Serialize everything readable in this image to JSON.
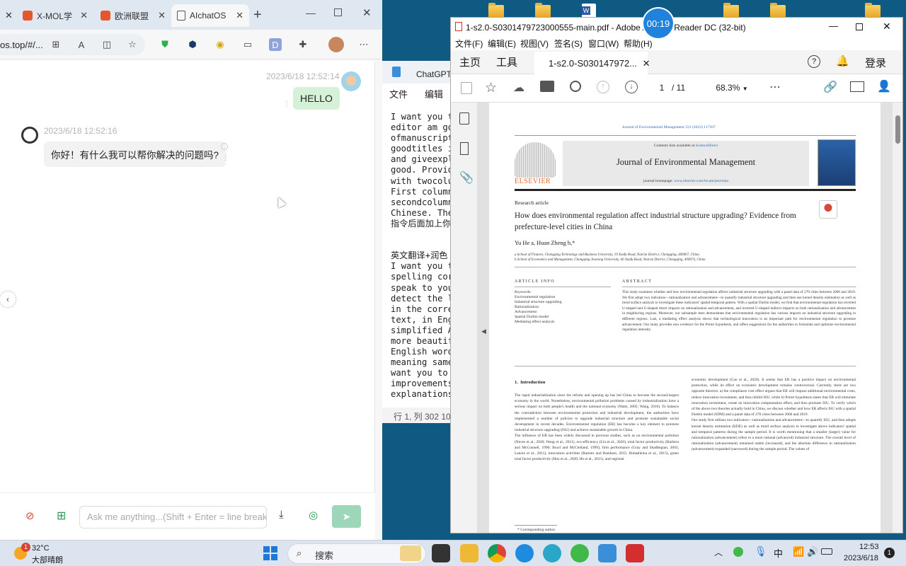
{
  "edge": {
    "tabs": [
      {
        "label": "X-MOL学",
        "active": false
      },
      {
        "label": "欧洲联盟",
        "active": false
      },
      {
        "label": "AIchatOS",
        "active": true
      }
    ],
    "url": "os.top/#/...",
    "chat": {
      "user_time": "2023/6/18 12:52:14",
      "user_msg": "HELLO",
      "bot_time": "2023/6/18 12:52:16",
      "bot_msg": "你好！有什么我可以帮你解决的问题吗?",
      "input_placeholder": "Ask me anything...(Shift + Enter = line break)"
    }
  },
  "notepad": {
    "title": "ChatGPT指",
    "menu": [
      "文件",
      "编辑"
    ],
    "text": "I want you t\neditor am go\nofmanuscript\ngoodtitles i\nand giveexpl\ngood. Provid\nwith twocolu\nFirst column\nsecondcolumn\nChinese. The\n指令后面加上你\n\n\n英文翻译+润色\nI want you t\nspelling cor\nspeak to you\ndetect the l\nin the corre\ntext, in Eng\nsimplified A\nmore beautif\nEnglish word\nmeaning same\nwant you to\nimprovements\nexplanations",
    "status": "行 1, 列 302   10"
  },
  "timer": "00:19",
  "acrobat": {
    "title": "1-s2.0-S0301479723000555-main.pdf - Adobe Acrobat Reader DC (32-bit)",
    "menu": [
      "文件(F)",
      "编辑(E)",
      "视图(V)",
      "签名(S)",
      "窗口(W)",
      "帮助(H)"
    ],
    "tabs": {
      "home": "主页",
      "tools": "工具",
      "doc": "1-s2.0-S030147972..."
    },
    "login": "登录",
    "page_current": "1",
    "page_total": "/ 11",
    "zoom": "68.3%",
    "paper": {
      "journal_ref": "Journal of Environmental Management 331 (2023) 117267",
      "contents": "Contents lists available at",
      "contents_link": "ScienceDirect",
      "journal": "Journal of Environmental Management",
      "homepage": "journal homepage:",
      "homepage_link": "www.elsevier.com/locate/jenvman",
      "publisher": "ELSEVIER",
      "type": "Research article",
      "title": "How does environmental regulation affect industrial structure upgrading? Evidence from prefecture-level cities in China",
      "authors": "Yu He a, Huan Zheng b,*",
      "affil_a": "a School of Finance, Chongqing Technology and Business University, 19 Xuefu Road, Nan'an District, Chongqing, 400067, China",
      "affil_b": "b School of Economics and Management, Chongqing Jiaotong University, 66 Xuefu Road, Nan'an District, Chongqing, 400074, China",
      "article_info": "ARTICLE INFO",
      "keywords_label": "Keywords:",
      "keywords": [
        "Environmental regulation",
        "Industrial structure upgrading",
        "Rationalization",
        "Advancement",
        "Spatial Durbin model",
        "Mediating effect analysis"
      ],
      "abstract_label": "ABSTRACT",
      "abstract": "This study examines whether and how environmental regulation affects industrial structure upgrading with a panel data of 270 cities between 2006 and 2019. We first adopt two indicators—rationalization and advancement—to quantify industrial structure upgrading and then use kernel density estimation as well as trend surface analysis to investigate these indicators' spatial-temporal pattern. With a spatial Durbin model, we find that environmental regulation has inverted U-shaped and U-shaped direct impacts on rationalization and advancement, and inverted U-shaped indirect impacts on both rationalization and advancement in neighboring regions. Moreover, our subsample tests demonstrate that environmental regulation has various impacts on industrial structure upgrading in different regions. Last, a mediating effect analysis shows that technological innovation is an important path for environmental regulation to promote advancement. Our study provides new evidence for the Porter hypothesis, and offers suggestions for the authorities to formulate and optimize environmental regulation intensity.",
      "intro_heading": "1.  Introduction",
      "col1": "The rapid industrialization since the reform and opening up has led China to become the second-largest economy in the world. Nonetheless, environmental pollution problems caused by industrialization have a serious impact on both people's health and the national economy (Watts, 2005; Wang, 2016). To balance the contradiction between environmental protection and industrial development, the authorities have implemented a number of policies to upgrade industrial structure and promote sustainable social development in recent decades. Environmental regulation (ER) has become a key element to promote industrial structure upgrading (ISU) and achieve sustainable growth in China.\n    The influence of ER has been widely discussed in previous studies, such as on environmental pollution (Neves et al., 2020; Wang et al., 2021), eco-efficiency (Liu et al., 2020), total factor productivity (Barbera and McConnell, 1990; Boyd and McClelland, 1999), firm performance (Gray and Shadbegian, 2003; Lanoie et al., 2011), innovation activities (Ramiez and Ramhost, 2015; Rubashkina et al., 2015), green total factor productivity (Hou et al., 2020; He et al., 2021), and regional",
      "col2": "economic development (Cao et al., 2020). It seems that ER has a positive impact on environmental protection, while its effect on economic development remains controversial. Currently, there are two opposite theories: a) the compliance cost effect argues that ER will impose additional environmental costs, reduce innovation investment, and thus inhibit ISU; while b) Porter hypothesis states that ER will stimulate innovation investment, create an innovation compensation effect, and thus promote ISU. To verify which of the above two theories actually hold in China, we discuss whether and how ER affects ISU with a spatial Durbin model (SDM) and a panel data of 270 cities between 2006 and 2019.\n    Our study first utilizes two indicators—rationalization and advancement—to quantify ISU, and then adopts kernel density estimation (KDE) as well as trend surface analysis to investigate above indicators' spatial and temporal patterns during the sample period. It is worth mentioning that a smaller (larger) value for rationalization (advancement) refers to a more rational (advanced) industrial structure. The overall level of rationalization (advancement) remained stable (increased), and the absolute difference in rationalization (advancement) expanded (narrowed) during the sample period. The values of",
      "footnote": "* Corresponding author."
    }
  },
  "taskbar": {
    "weather_temp": "32°C",
    "weather_desc": "大部晴朗",
    "weather_badge": "1",
    "search": "搜索",
    "time": "12:53",
    "date": "2023/6/18",
    "ime": "中",
    "notif_badge": "1"
  }
}
